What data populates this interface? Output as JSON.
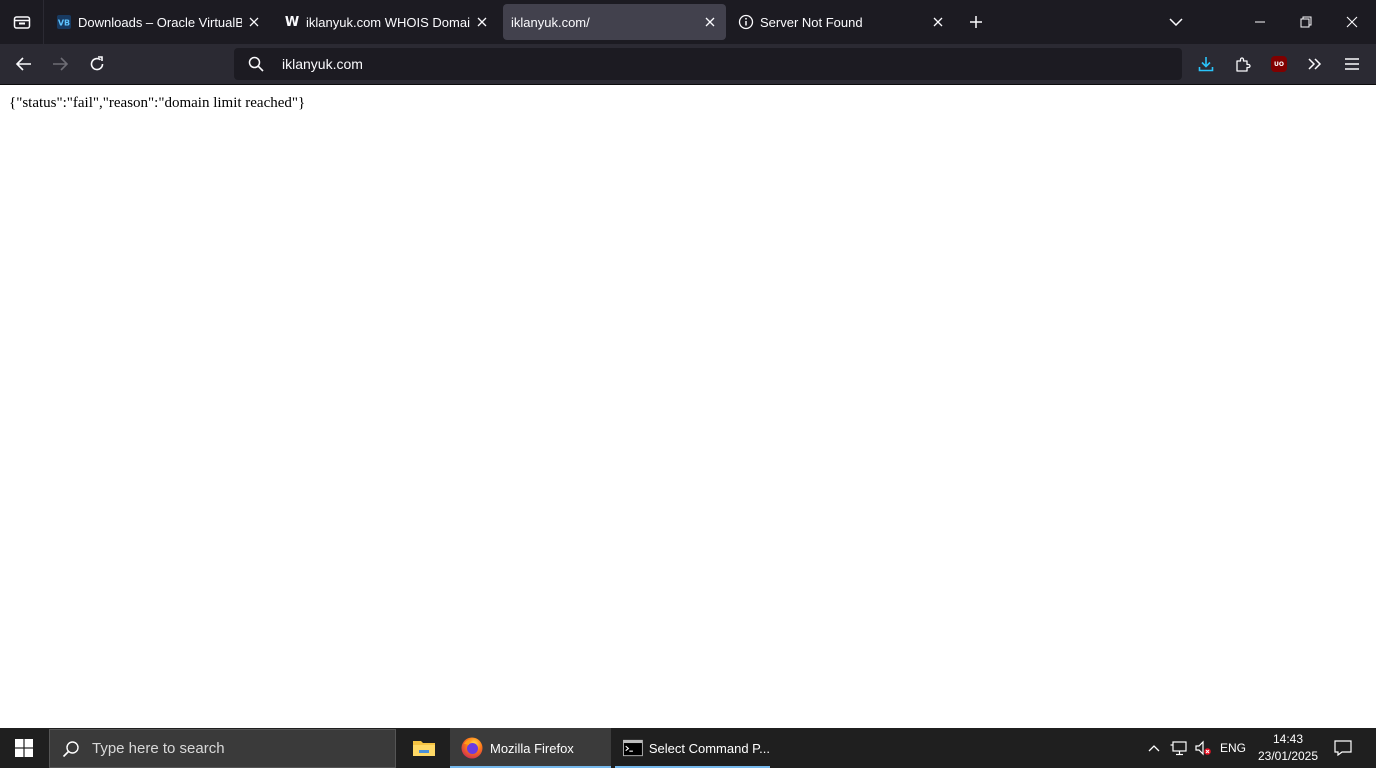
{
  "browser": {
    "tabs": [
      {
        "title": "Downloads – Oracle VirtualBox",
        "favicon": "virtualbox-icon",
        "selected": false
      },
      {
        "title": "iklanyuk.com WHOIS Domain Name",
        "favicon": "w-logo",
        "favicon_text": "W",
        "selected": false
      },
      {
        "title": "iklanyuk.com/",
        "favicon": "none",
        "selected": true
      },
      {
        "title": "Server Not Found",
        "favicon": "info-icon",
        "selected": false
      }
    ],
    "url": "iklanyuk.com",
    "ublock_badge": "UO"
  },
  "page": {
    "body_text": "{\"status\":\"fail\",\"reason\":\"domain limit reached\"}"
  },
  "taskbar": {
    "search_placeholder": "Type here to search",
    "apps": [
      {
        "name": "file-explorer",
        "label": ""
      },
      {
        "name": "firefox",
        "label": "Mozilla Firefox",
        "active": true
      },
      {
        "name": "command-prompt",
        "label": "Select Command P..."
      }
    ],
    "language": "ENG",
    "time": "14:43",
    "date": "23/01/2025"
  },
  "colors": {
    "tabbar_bg": "#1c1b22",
    "navbar_bg": "#2b2a33",
    "selected_tab": "#42414d",
    "download_accent": "#2ac3fa",
    "taskbar_bg": "#1f1f1f",
    "taskbar_active_underline": "#76b9ed"
  }
}
